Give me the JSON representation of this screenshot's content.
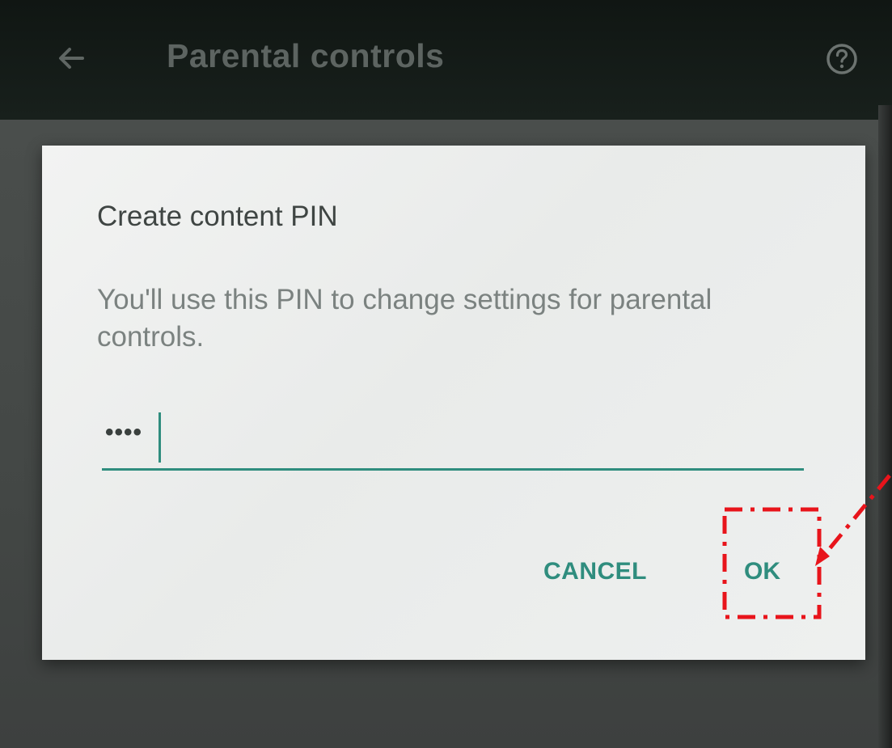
{
  "app_bar": {
    "title": "Parental controls",
    "back_icon": "arrow-back-icon",
    "help_icon": "help-circle-icon"
  },
  "dialog": {
    "title": "Create content PIN",
    "message": "You'll use this PIN to change settings for parental controls.",
    "pin_value": "••••",
    "cancel_label": "CANCEL",
    "ok_label": "OK"
  },
  "colors": {
    "accent": "#2f8d7e",
    "highlight": "#e8141b"
  }
}
